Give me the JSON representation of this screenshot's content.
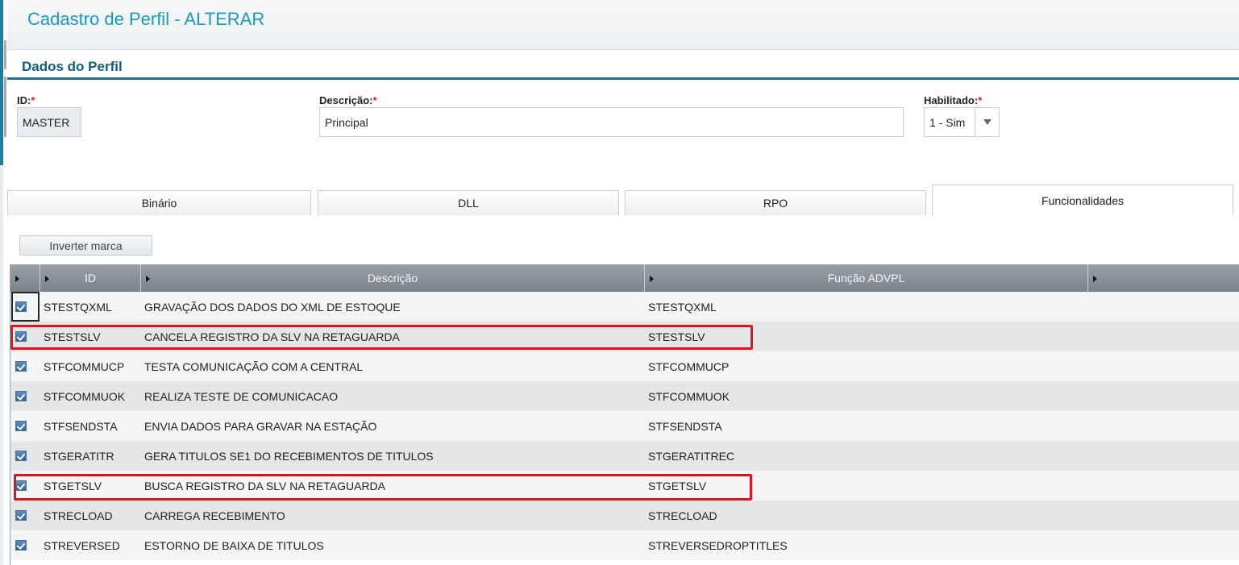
{
  "header": {
    "title": "Cadastro de Perfil - ALTERAR"
  },
  "section": {
    "title": "Dados do Perfil"
  },
  "fields": {
    "id": {
      "label": "ID:",
      "required_mark": "*",
      "value": "MASTER"
    },
    "descricao": {
      "label": "Descrição:",
      "required_mark": "*",
      "value": "Principal"
    },
    "habilitado": {
      "label": "Habilitado:",
      "required_mark": "*",
      "value": "1 - Sim"
    }
  },
  "tabs": [
    {
      "label": "Binário",
      "active": false
    },
    {
      "label": "DLL",
      "active": false
    },
    {
      "label": "RPO",
      "active": false
    },
    {
      "label": "Funcionalidades",
      "active": true
    }
  ],
  "actions": {
    "invert_label": "Inverter marca"
  },
  "table": {
    "columns": [
      "ID",
      "Descrição",
      "Função ADVPL"
    ],
    "rows": [
      {
        "checked": true,
        "id": "STESTQXML",
        "descricao": "GRAVAÇÃO DOS DADOS DO XML DE ESTOQUE",
        "funcao": "STESTQXML",
        "highlighted": false,
        "focused": true
      },
      {
        "checked": true,
        "id": "STESTSLV",
        "descricao": "CANCELA REGISTRO DA SLV NA RETAGUARDA",
        "funcao": "STESTSLV",
        "highlighted": true,
        "focused": false
      },
      {
        "checked": true,
        "id": "STFCOMMUCP",
        "descricao": "TESTA COMUNICAÇÃO COM A CENTRAL",
        "funcao": "STFCOMMUCP",
        "highlighted": false,
        "focused": false
      },
      {
        "checked": true,
        "id": "STFCOMMUOK",
        "descricao": "REALIZA TESTE DE COMUNICACAO",
        "funcao": "STFCOMMUOK",
        "highlighted": false,
        "focused": false
      },
      {
        "checked": true,
        "id": "STFSENDSTA",
        "descricao": "ENVIA DADOS PARA GRAVAR NA ESTAÇÃO",
        "funcao": "STFSENDSTA",
        "highlighted": false,
        "focused": false
      },
      {
        "checked": true,
        "id": "STGERATITR",
        "descricao": "GERA TITULOS SE1 DO RECEBIMENTOS DE TITULOS",
        "funcao": "STGERATITREC",
        "highlighted": false,
        "focused": false
      },
      {
        "checked": true,
        "id": "STGETSLV",
        "descricao": "BUSCA REGISTRO DA SLV NA RETAGUARDA",
        "funcao": "STGETSLV",
        "highlighted": true,
        "focused": false
      },
      {
        "checked": true,
        "id": "STRECLOAD",
        "descricao": "CARREGA RECEBIMENTO",
        "funcao": "STRECLOAD",
        "highlighted": false,
        "focused": false
      },
      {
        "checked": true,
        "id": "STREVERSED",
        "descricao": "ESTORNO DE BAIXA DE TITULOS",
        "funcao": "STREVERSEDROPTITLES",
        "highlighted": false,
        "focused": false
      }
    ]
  },
  "colors": {
    "title": "#1a9ac0",
    "section": "#135d7a",
    "highlight": "#e0141b",
    "required": "#e02020"
  }
}
